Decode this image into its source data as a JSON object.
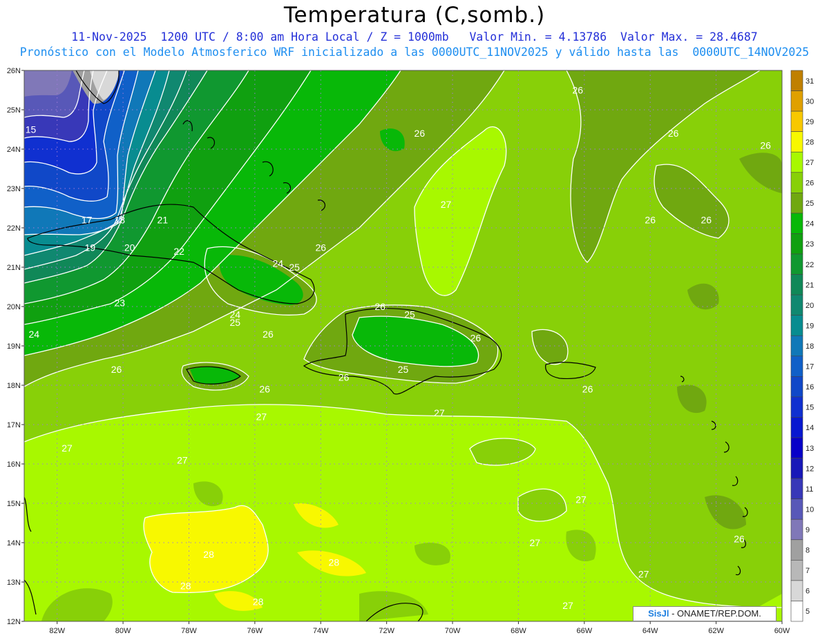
{
  "header": {
    "title": "Temperatura (C,somb.)",
    "subtitle1": "11-Nov-2025  1200 UTC / 8:00 am Hora Local / Z = 1000mb   Valor Min. = 4.13786  Valor Max. = 28.4687",
    "subtitle2": "Pronóstico con el Modelo Atmosferico WRF inicializado a las 0000UTC_11NOV2025 y válido hasta las  0000UTC_14NOV2025"
  },
  "map": {
    "lon_range": [
      -83,
      -60
    ],
    "lat_range": [
      12,
      26
    ],
    "lon_ticks": [
      "82W",
      "80W",
      "78W",
      "76W",
      "74W",
      "72W",
      "70W",
      "68W",
      "66W",
      "64W",
      "62W",
      "60W"
    ],
    "lat_ticks": [
      "26N",
      "25N",
      "24N",
      "23N",
      "22N",
      "21N",
      "20N",
      "19N",
      "18N",
      "17N",
      "16N",
      "15N",
      "14N",
      "13N",
      "12N"
    ],
    "grid": true,
    "contour_labels": [
      {
        "text": "15",
        "lon": -82.8,
        "lat": 24.5
      },
      {
        "text": "17",
        "lon": -81.1,
        "lat": 22.2
      },
      {
        "text": "18",
        "lon": -80.1,
        "lat": 22.2
      },
      {
        "text": "19",
        "lon": -81.0,
        "lat": 21.5
      },
      {
        "text": "20",
        "lon": -79.8,
        "lat": 21.5
      },
      {
        "text": "21",
        "lon": -78.8,
        "lat": 22.2
      },
      {
        "text": "22",
        "lon": -78.3,
        "lat": 21.4
      },
      {
        "text": "23",
        "lon": -80.1,
        "lat": 20.1
      },
      {
        "text": "24",
        "lon": -82.7,
        "lat": 19.3
      },
      {
        "text": "24",
        "lon": -76.6,
        "lat": 19.8
      },
      {
        "text": "24",
        "lon": -75.3,
        "lat": 21.1
      },
      {
        "text": "25",
        "lon": -74.8,
        "lat": 21.0
      },
      {
        "text": "25",
        "lon": -76.6,
        "lat": 19.6
      },
      {
        "text": "26",
        "lon": -80.2,
        "lat": 18.4
      },
      {
        "text": "26",
        "lon": -75.6,
        "lat": 19.3
      },
      {
        "text": "26",
        "lon": -74.0,
        "lat": 21.5
      },
      {
        "text": "26",
        "lon": -75.7,
        "lat": 17.9
      },
      {
        "text": "26",
        "lon": -73.3,
        "lat": 18.2
      },
      {
        "text": "26",
        "lon": -72.2,
        "lat": 20.0
      },
      {
        "text": "25",
        "lon": -71.3,
        "lat": 19.8
      },
      {
        "text": "25",
        "lon": -71.5,
        "lat": 18.4
      },
      {
        "text": "26",
        "lon": -69.3,
        "lat": 19.2
      },
      {
        "text": "26",
        "lon": -71.0,
        "lat": 24.4
      },
      {
        "text": "27",
        "lon": -70.2,
        "lat": 22.6
      },
      {
        "text": "26",
        "lon": -66.2,
        "lat": 25.5
      },
      {
        "text": "26",
        "lon": -63.3,
        "lat": 24.4
      },
      {
        "text": "26",
        "lon": -60.5,
        "lat": 24.1
      },
      {
        "text": "26",
        "lon": -64.0,
        "lat": 22.2
      },
      {
        "text": "26",
        "lon": -62.3,
        "lat": 22.2
      },
      {
        "text": "26",
        "lon": -65.9,
        "lat": 17.9
      },
      {
        "text": "27",
        "lon": -75.8,
        "lat": 17.2
      },
      {
        "text": "27",
        "lon": -70.4,
        "lat": 17.3
      },
      {
        "text": "27",
        "lon": -81.7,
        "lat": 16.4
      },
      {
        "text": "27",
        "lon": -78.2,
        "lat": 16.1
      },
      {
        "text": "27",
        "lon": -66.1,
        "lat": 15.1
      },
      {
        "text": "27",
        "lon": -67.5,
        "lat": 14.0
      },
      {
        "text": "26",
        "lon": -61.3,
        "lat": 14.1
      },
      {
        "text": "27",
        "lon": -64.2,
        "lat": 13.2
      },
      {
        "text": "27",
        "lon": -66.5,
        "lat": 12.4
      },
      {
        "text": "28",
        "lon": -77.4,
        "lat": 13.7
      },
      {
        "text": "28",
        "lon": -73.6,
        "lat": 13.5
      },
      {
        "text": "28",
        "lon": -78.1,
        "lat": 12.9
      },
      {
        "text": "28",
        "lon": -75.9,
        "lat": 12.5
      }
    ]
  },
  "colorbar": {
    "levels": [
      "31",
      "30",
      "29",
      "28",
      "27",
      "26",
      "25",
      "24",
      "23",
      "22",
      "21",
      "20",
      "19",
      "18",
      "17",
      "16",
      "15",
      "14",
      "13",
      "12",
      "11",
      "10",
      "9",
      "8",
      "7",
      "6",
      "5"
    ],
    "colors": [
      "#c08000",
      "#e0a000",
      "#f8c800",
      "#f8f800",
      "#a8f800",
      "#88d008",
      "#70a810",
      "#08b808",
      "#10a010",
      "#109830",
      "#108858",
      "#108870",
      "#088c90",
      "#1078b8",
      "#1060c8",
      "#1048c8",
      "#1030d0",
      "#0818d0",
      "#0800c8",
      "#1818b8",
      "#3838b8",
      "#5858b8",
      "#8078b8",
      "#a0a0a0",
      "#b8b8b8",
      "#d8d8d8",
      "#ffffff"
    ]
  },
  "credit": {
    "part1": "SisJl",
    "part2": "- ONAMET/REP.DOM."
  }
}
